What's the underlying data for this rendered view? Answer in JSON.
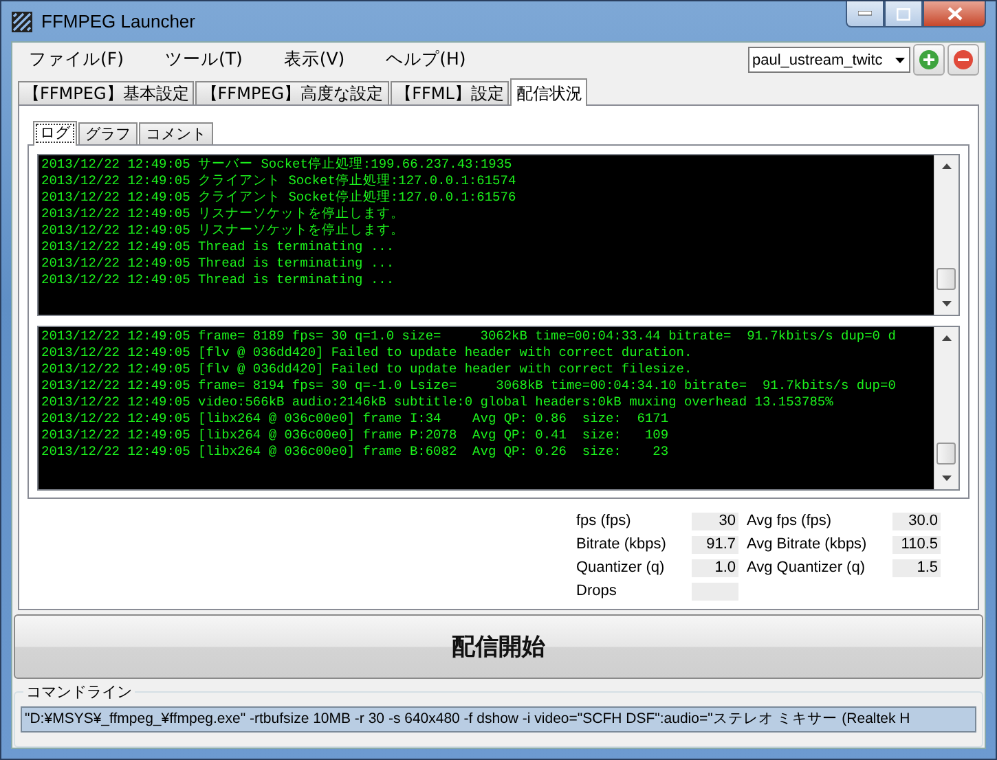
{
  "window": {
    "title": "FFMPEG Launcher"
  },
  "menu": [
    "ファイル(F)",
    "ツール(T)",
    "表示(V)",
    "ヘルプ(H)"
  ],
  "profile": {
    "value": "paul_ustream_twitc"
  },
  "tabs": [
    {
      "label": "【FFMPEG】基本設定",
      "selected": false
    },
    {
      "label": "【FFMPEG】高度な設定",
      "selected": false
    },
    {
      "label": "【FFML】設定",
      "selected": false
    },
    {
      "label": "配信状況",
      "selected": true
    }
  ],
  "subtabs": [
    {
      "label": "ログ",
      "selected": true
    },
    {
      "label": "グラフ",
      "selected": false
    },
    {
      "label": "コメント",
      "selected": false
    }
  ],
  "status_log": [
    "2013/12/22 12:49:05 サーバー Socket停止処理:199.66.237.43:1935",
    "2013/12/22 12:49:05 クライアント Socket停止処理:127.0.0.1:61574",
    "2013/12/22 12:49:05 クライアント Socket停止処理:127.0.0.1:61576",
    "2013/12/22 12:49:05 リスナーソケットを停止します。",
    "2013/12/22 12:49:05 リスナーソケットを停止します。",
    "2013/12/22 12:49:05 Thread is terminating ...",
    "2013/12/22 12:49:05 Thread is terminating ...",
    "2013/12/22 12:49:05 Thread is terminating ..."
  ],
  "ffmpeg_log": [
    "2013/12/22 12:49:05 frame= 8189 fps= 30 q=1.0 size=     3062kB time=00:04:33.44 bitrate=  91.7kbits/s dup=0 d",
    "2013/12/22 12:49:05 [flv @ 036dd420] Failed to update header with correct duration.",
    "2013/12/22 12:49:05 [flv @ 036dd420] Failed to update header with correct filesize.",
    "2013/12/22 12:49:05 frame= 8194 fps= 30 q=-1.0 Lsize=     3068kB time=00:04:34.10 bitrate=  91.7kbits/s dup=0",
    "2013/12/22 12:49:05 video:566kB audio:2146kB subtitle:0 global headers:0kB muxing overhead 13.153785%",
    "2013/12/22 12:49:05 [libx264 @ 036c00e0] frame I:34    Avg QP: 0.86  size:  6171",
    "2013/12/22 12:49:05 [libx264 @ 036c00e0] frame P:2078  Avg QP: 0.41  size:   109",
    "2013/12/22 12:49:05 [libx264 @ 036c00e0] frame B:6082  Avg QP: 0.26  size:    23"
  ],
  "stats": [
    {
      "label": "fps (fps)",
      "value": "30",
      "avg_label": "Avg fps (fps)",
      "avg_value": "30.0"
    },
    {
      "label": "Bitrate (kbps)",
      "value": "91.7",
      "avg_label": "Avg Bitrate (kbps)",
      "avg_value": "110.5"
    },
    {
      "label": "Quantizer (q)",
      "value": "1.0",
      "avg_label": "Avg Quantizer (q)",
      "avg_value": "1.5"
    },
    {
      "label": "Drops"
    }
  ],
  "start_button": "配信開始",
  "command_line": {
    "label": "コマンドライン",
    "value": "\"D:¥MSYS¥_ffmpeg_¥ffmpeg.exe\" -rtbufsize 10MB -r 30 -s 640x480 -f dshow -i video=\"SCFH DSF\":audio=\"ステレオ ミキサー (Realtek H"
  }
}
